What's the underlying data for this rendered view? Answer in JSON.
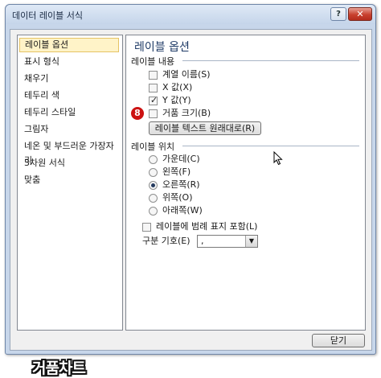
{
  "window": {
    "title": "데이터 레이블 서식",
    "help_label": "?",
    "close_label": "✕"
  },
  "categories": [
    {
      "label": "레이블 옵션",
      "selected": true
    },
    {
      "label": "표시 형식",
      "selected": false
    },
    {
      "label": "채우기",
      "selected": false
    },
    {
      "label": "테두리 색",
      "selected": false
    },
    {
      "label": "테두리 스타일",
      "selected": false
    },
    {
      "label": "그림자",
      "selected": false
    },
    {
      "label": "네온 및 부드러운 가장자리",
      "selected": false
    },
    {
      "label": "3차원 서식",
      "selected": false
    },
    {
      "label": "맞춤",
      "selected": false
    }
  ],
  "panel": {
    "title": "레이블 옵션",
    "contents_heading": "레이블 내용",
    "contents": [
      {
        "label": "계열 이름(S)",
        "checked": false
      },
      {
        "label": "X 값(X)",
        "checked": false
      },
      {
        "label": "Y 값(Y)",
        "checked": true
      },
      {
        "label": "거품 크기(B)",
        "checked": false
      }
    ],
    "reset_button": "레이블 텍스트 원래대로(R)",
    "step_badge": "8",
    "position_heading": "레이블 위치",
    "positions": [
      {
        "label": "가운데(C)",
        "selected": false
      },
      {
        "label": "왼쪽(F)",
        "selected": false
      },
      {
        "label": "오른쪽(R)",
        "selected": true
      },
      {
        "label": "위쪽(O)",
        "selected": false
      },
      {
        "label": "아래쪽(W)",
        "selected": false
      }
    ],
    "legend_key_label": "레이블에 범례 표지 포함(L)",
    "legend_key_checked": false,
    "separator_label": "구분 기호(E)",
    "separator_value": ","
  },
  "footer": {
    "close_button": "닫기"
  },
  "watermark": "거품차트",
  "icons": {
    "cursor": "mouse-pointer-icon",
    "dropdown": "chevron-down-icon"
  }
}
